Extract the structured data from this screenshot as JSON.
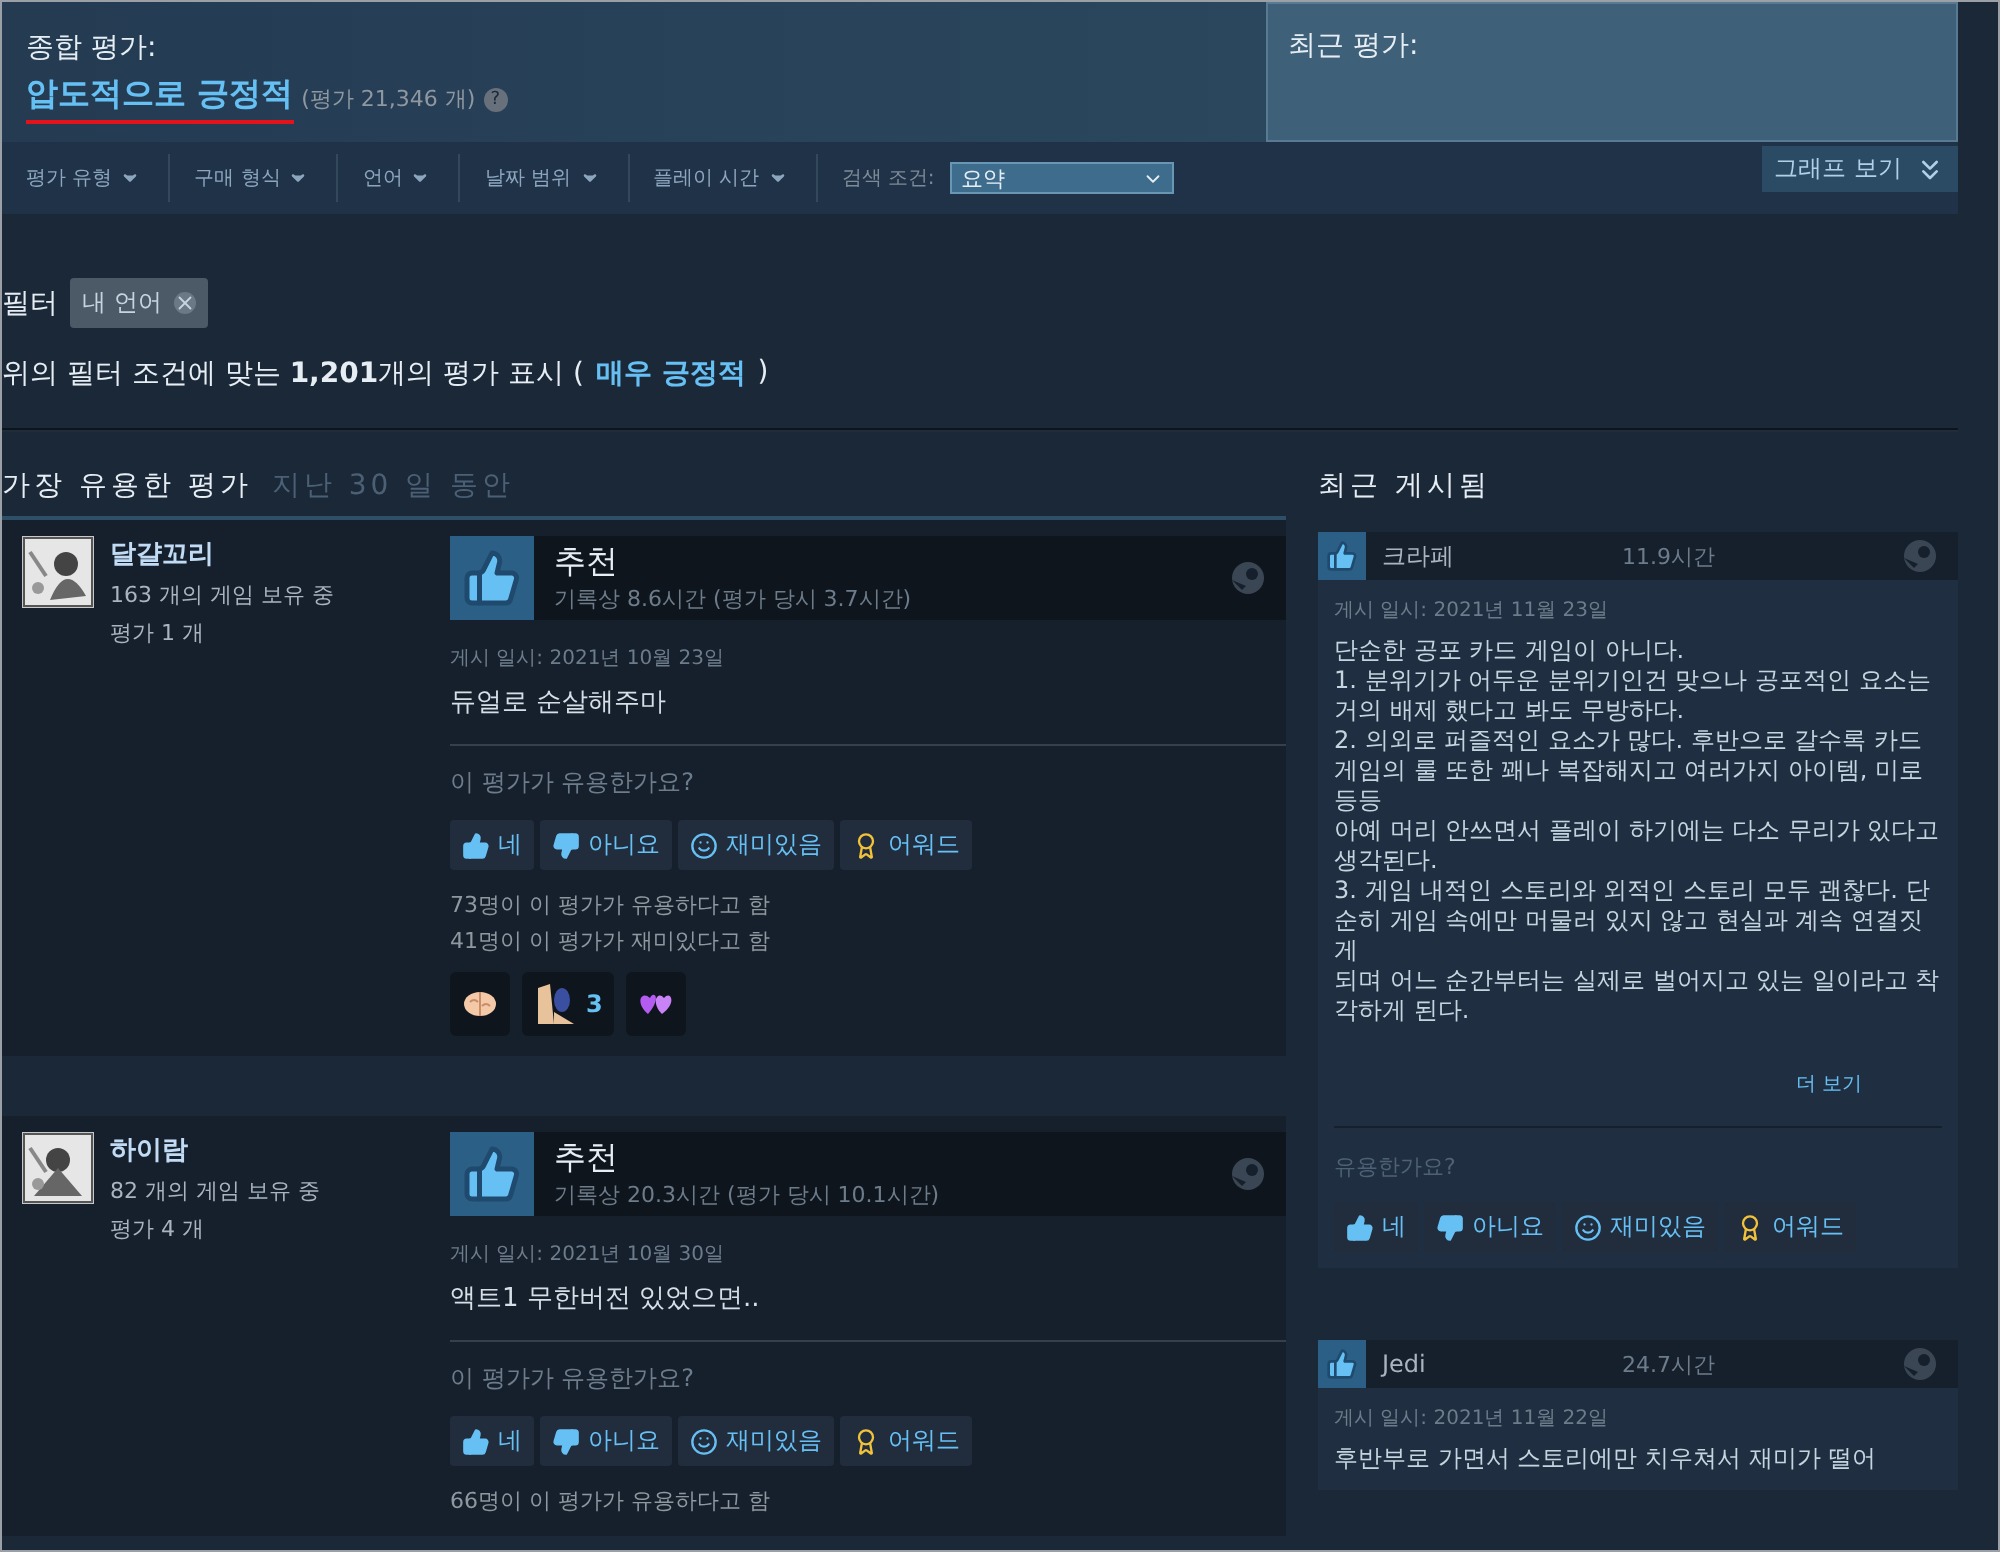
{
  "overall": {
    "label": "종합 평가:",
    "rating": "압도적으로 긍정적",
    "count": "(평가 21,346 개)",
    "help": "?"
  },
  "recent": {
    "label": "최근 평가:"
  },
  "filters": [
    {
      "label": "평가 유형"
    },
    {
      "label": "구매 형식"
    },
    {
      "label": "언어"
    },
    {
      "label": "날짜 범위"
    },
    {
      "label": "플레이 시간"
    }
  ],
  "search": {
    "label": "검색 조건:",
    "value": "요약"
  },
  "graph_button": "그래프 보기",
  "filter_tags": {
    "label": "필터",
    "tags": [
      {
        "label": "내 언어"
      }
    ]
  },
  "summary": {
    "text": "위의 필터 조건에 맞는 **1,201**개의 평가 표시 (",
    "link": "매우 긍정적",
    "end": ")"
  },
  "helpful": {
    "title": "가장 유용한 평가",
    "period": "지난 30 일 동안"
  },
  "reviews": [
    {
      "author": "달걀꼬리",
      "games": "163 개의 게임 보유 중",
      "count": "평가 1 개",
      "verdict": "추천",
      "hours": "기록상 8.6시간 (평가 당시 3.7시간)",
      "date": "게시 일시: 2021년 10월 23일",
      "text": "듀얼로 순살해주마",
      "question": "이 평가가 유용한가요?",
      "buttons": [
        {
          "kind": "yes",
          "label": "네"
        },
        {
          "kind": "no",
          "label": "아니요"
        },
        {
          "kind": "funny",
          "label": "재미있음"
        },
        {
          "kind": "award",
          "label": "어워드"
        }
      ],
      "stats": [
        "73명이 이 평가가 유용하다고 함",
        "41명이 이 평가가 재미있다고 함"
      ],
      "awards": [
        {
          "kind": "brain"
        },
        {
          "kind": "figure",
          "count": "3"
        },
        {
          "kind": "hearts"
        }
      ]
    },
    {
      "author": "하이람",
      "games": "82 개의 게임 보유 중",
      "count": "평가 4 개",
      "verdict": "추천",
      "hours": "기록상 20.3시간 (평가 당시 10.1시간)",
      "date": "게시 일시: 2021년 10월 30일",
      "text": "액트1 무한버전 있었으면..",
      "question": "이 평가가 유용한가요?",
      "buttons": [
        {
          "kind": "yes",
          "label": "네"
        },
        {
          "kind": "no",
          "label": "아니요"
        },
        {
          "kind": "funny",
          "label": "재미있음"
        },
        {
          "kind": "award",
          "label": "어워드"
        }
      ],
      "stats": [
        "66명이 이 평가가 유용하다고 함"
      ]
    }
  ],
  "recent_posts": {
    "title": "최근 게시됨",
    "items": [
      {
        "author": "크라페",
        "hours": "11.9시간",
        "date": "게시 일시: 2021년 11월 23일",
        "text": "단순한 공포 카드 게임이 아니다.\n1. 분위기가 어두운 분위기인건 맞으나 공포적인 요소는 거의 배제 했다고 봐도 무방하다.\n2. 의외로 퍼즐적인 요소가 많다. 후반으로 갈수록 카드게임의 룰 또한 꽤나 복잡해지고 여러가지 아이템, 미로 등등\n아예 머리 안쓰면서 플레이 하기에는 다소 무리가 있다고 생각된다.\n3. 게임 내적인 스토리와 외적인 스토리 모두 괜찮다. 단순히 게임 속에만 머물러 있지 않고 현실과 계속 연결짓게\n되며 어느 순간부터는 실제로 벌어지고 있는 일이라고 착각하게 된다.",
        "more": "더 보기",
        "question": "유용한가요?",
        "buttons": [
          {
            "kind": "yes",
            "label": "네"
          },
          {
            "kind": "no",
            "label": "아니요"
          },
          {
            "kind": "funny",
            "label": "재미있음"
          },
          {
            "kind": "award",
            "label": "어워드"
          }
        ]
      },
      {
        "author": "Jedi",
        "hours": "24.7시간",
        "date": "게시 일시: 2021년 11월 22일",
        "text": "후반부로 가면서 스토리에만 치우쳐서 재미가 떨어"
      }
    ]
  }
}
